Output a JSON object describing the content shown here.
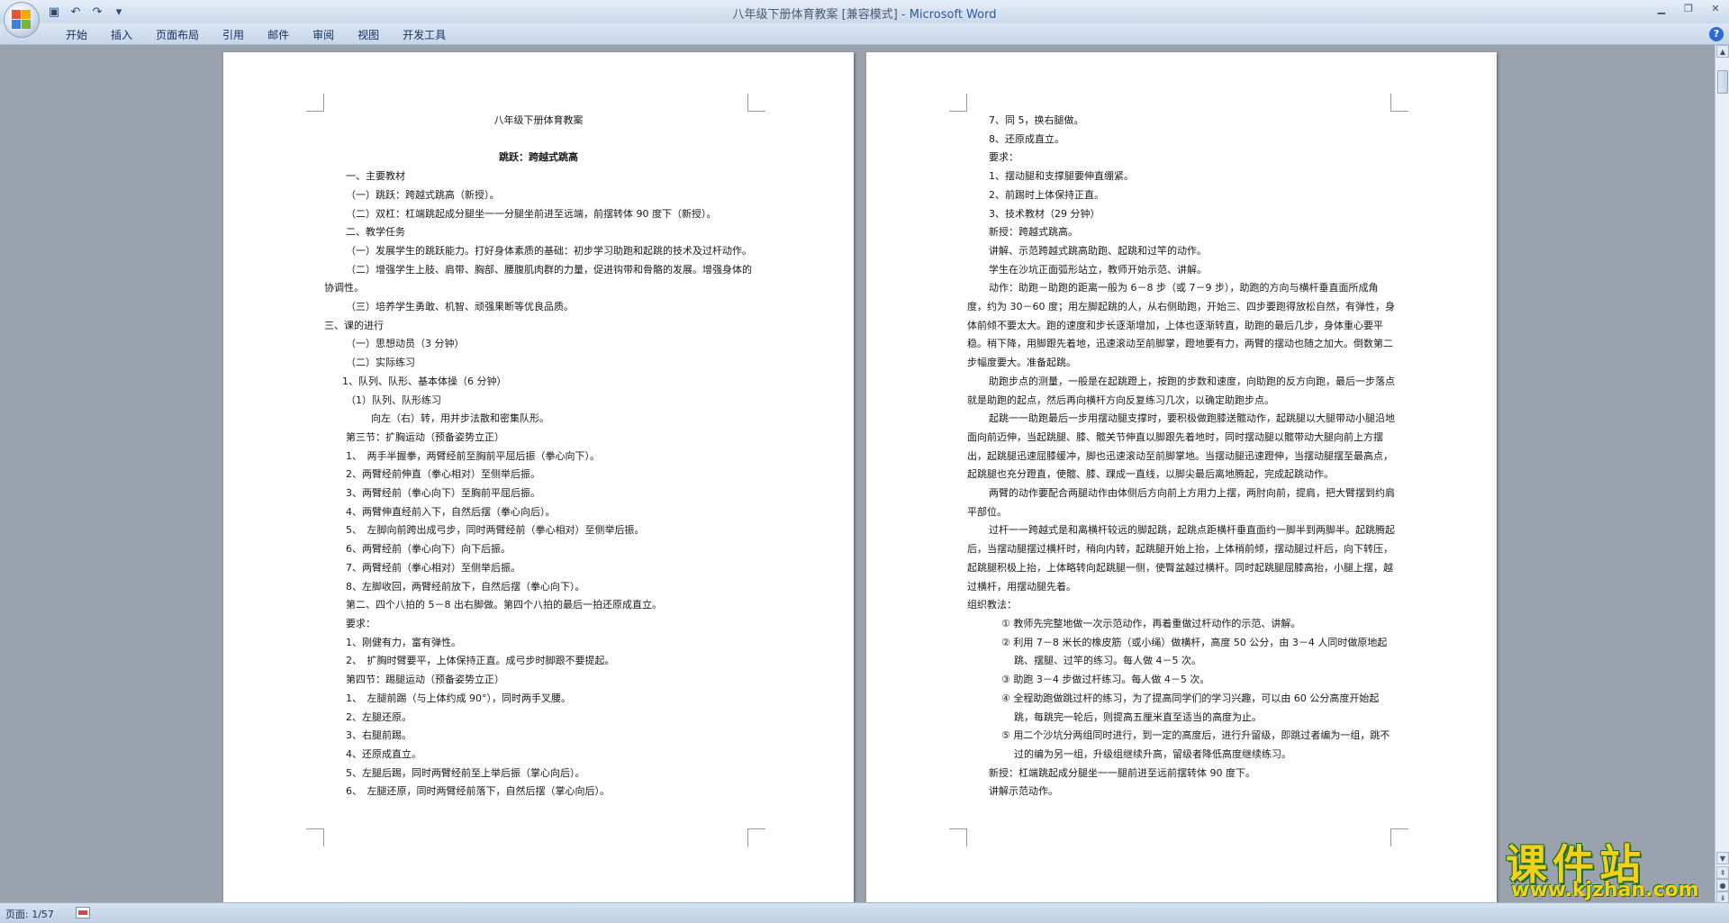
{
  "window": {
    "title": "八年级下册体育教案 [兼容模式] - ",
    "app": "Microsoft Word"
  },
  "qat": {
    "icons": [
      "save-icon",
      "undo-icon",
      "redo-icon",
      "customize-icon"
    ]
  },
  "ribbon": {
    "tabs": [
      "开始",
      "插入",
      "页面布局",
      "引用",
      "邮件",
      "审阅",
      "视图",
      "开发工具"
    ]
  },
  "page1": {
    "lines": [
      "八年级下册体育教案",
      "",
      "跳跃：跨越式跳高",
      "一、主要教材",
      "（一）跳跃：跨越式跳高（新授）。",
      "（二）双杠：杠端跳起成分腿坐一一分腿坐前进至远端，前摆转体 90 度下（新授）。",
      "二、教学任务",
      "（一）发展学生的跳跃能力。打好身体素质的基础：初步学习助跑和起跳的技术及过杆动作。",
      "（二）增强学生上肢、肩带、胸部、腰腹肌肉群的力量，促进钩带和骨骼的发展。增强身体的协调性。",
      "（三）培养学生勇敢、机智、顽强果断等优良品质。",
      "三、课的进行",
      "（一）思想动员（3 分钟）",
      "（二）实际练习",
      "1、队列、队形、基本体操（6 分钟）",
      "（1）队列、队形练习",
      "向左（右）转，用并步法散和密集队形。",
      "第三节：扩胸运动（预备姿势立正）",
      "1、　两手半握拳，两臂经前至胸前平屈后振（拳心向下）。",
      "2、两臂经前伸直（拳心相对）至侧举后振。",
      "3、两臂经前（拳心向下）至胸前平屈后振。",
      "4、两臂伸直经前入下，自然后摆（拳心向后）。",
      "5、　左脚向前跨出成弓步，同时两臂经前（拳心相对）至侧举后振。",
      "6、两臂经前（拳心向下）向下后振。",
      "7、两臂经前（拳心相对）至侧举后振。",
      "8、左脚收回，两臂经前放下，自然后摆（拳心向下）。",
      "第二、四个八拍的 5－8 出右脚做。第四个八拍的最后一拍还原成直立。",
      "要求：",
      "1、刚健有力，富有弹性。",
      "2、　扩胸时臂要平，上体保持正直。成弓步时脚跟不要提起。",
      "第四节：踢腿运动（预备姿势立正）",
      "1、　左腿前踢（与上体约成 90°），同时两手叉腰。",
      "2、左腿还原。",
      "3、右腿前踢。",
      "4、还原成直立。",
      "5、左腿后踢，同时两臂经前至上举后振（掌心向后）。",
      "6、　左腿还原，同时两臂经前落下，自然后摆（掌心向后）。"
    ]
  },
  "page2": {
    "lines": [
      "7、同 5，换右腿做。",
      "8、还原成直立。",
      "要求：",
      "1、摆动腿和支撑腿要伸直绷紧。",
      "2、前踢时上体保持正直。",
      "3、技术教材（29 分钟）",
      "新授：跨越式跳高。",
      "讲解、示范跨越式跳高助跑、起跳和过竿的动作。",
      "学生在沙坑正面弧形站立，教师开始示范、讲解。",
      "动作：助跑－助跑的距离一般为 6－8 步（或 7－9 步），助跑的方向与横杆垂直面所成角度，约为 30－60 度；用左脚起跳的人，从右侧助跑，开始三、四步要跑得放松自然，有弹性，身体前倾不要太大。跑的速度和步长逐渐增加，上体也逐渐转直，助跑的最后几步，身体重心要平稳。稍下降，用脚跟先着地，迅速滚动至前脚掌，蹬地要有力，两臂的摆动也随之加大。倒数第二步幅度要大。准备起跳。",
      "助跑步点的测量，一般是在起跳蹬上，按跑的步数和速度，向助跑的反方向跑，最后一步落点就是助跑的起点，然后再向横杆方向反复练习几次，以确定助跑步点。",
      "起跳一一助跑最后一步用摆动腿支撑时，要积极做跑膝送髋动作，起跳腿以大腿带动小腿沿地面向前迈伸，当起跳腿、膝、髋关节伸直以脚跟先着地时，同时摆动腿以髋带动大腿向前上方摆出，起跳腿迅速屈膝缓冲，脚也迅速滚动至前脚掌地。当摆动腿迅速蹬伸，当摆动腿摆至最高点，起跳腿也充分蹬直，使髋、膝、踝成一直线，以脚尖最后离地腾起，完成起跳动作。",
      "两臂的动作要配合两腿动作由体侧后方向前上方用力上摆，两肘向前，提肩，把大臂摆到约肩平部位。",
      "过杆一一跨越式是和离横杆较远的脚起跳，起跳点距横杆垂直面约一脚半到两脚半。起跳腾起后，当摆动腿摆过横杆时，稍向内转，起跳腿开始上抬，上体稍前倾，摆动腿过杆后，向下转压，起跳腿积极上抬，上体略转向起跳腿一侧，使臀盆越过横杆。同时起跳腿屈膝高抬，小腿上摆，越过横杆，用摆动腿先着。",
      "组织教法：",
      "① 教师先完整地做一次示范动作，再着重做过杆动作的示范、讲解。",
      "② 利用 7－8 米长的橡皮筋（或小绳）做横杆，高度 50 公分，由 3－4 人同时做原地起跳、摆腿、过竿的练习。每人做 4－5 次。",
      "③ 助跑 3－4 步做过杆练习。每人做 4－5 次。",
      "④ 全程助跑做跳过杆的练习，为了提高同学们的学习兴趣，可以由 60 公分高度开始起跳，每跳完一轮后，则提高五厘米直至适当的高度为止。",
      "⑤ 用二个沙坑分两组同时进行，到一定的高度后，进行升留级，即跳过者编为一组，跳不过的编为另一组，升级组继续升高，留级者降低高度继续练习。",
      "新授：杠端跳起成分腿坐一一腿前进至远前摆转体 90 度下。",
      "讲解示范动作。"
    ]
  },
  "statusbar": {
    "page": "页面: 1/57"
  },
  "watermark": {
    "title": "课件站",
    "url": "www.kjzhan.com"
  }
}
